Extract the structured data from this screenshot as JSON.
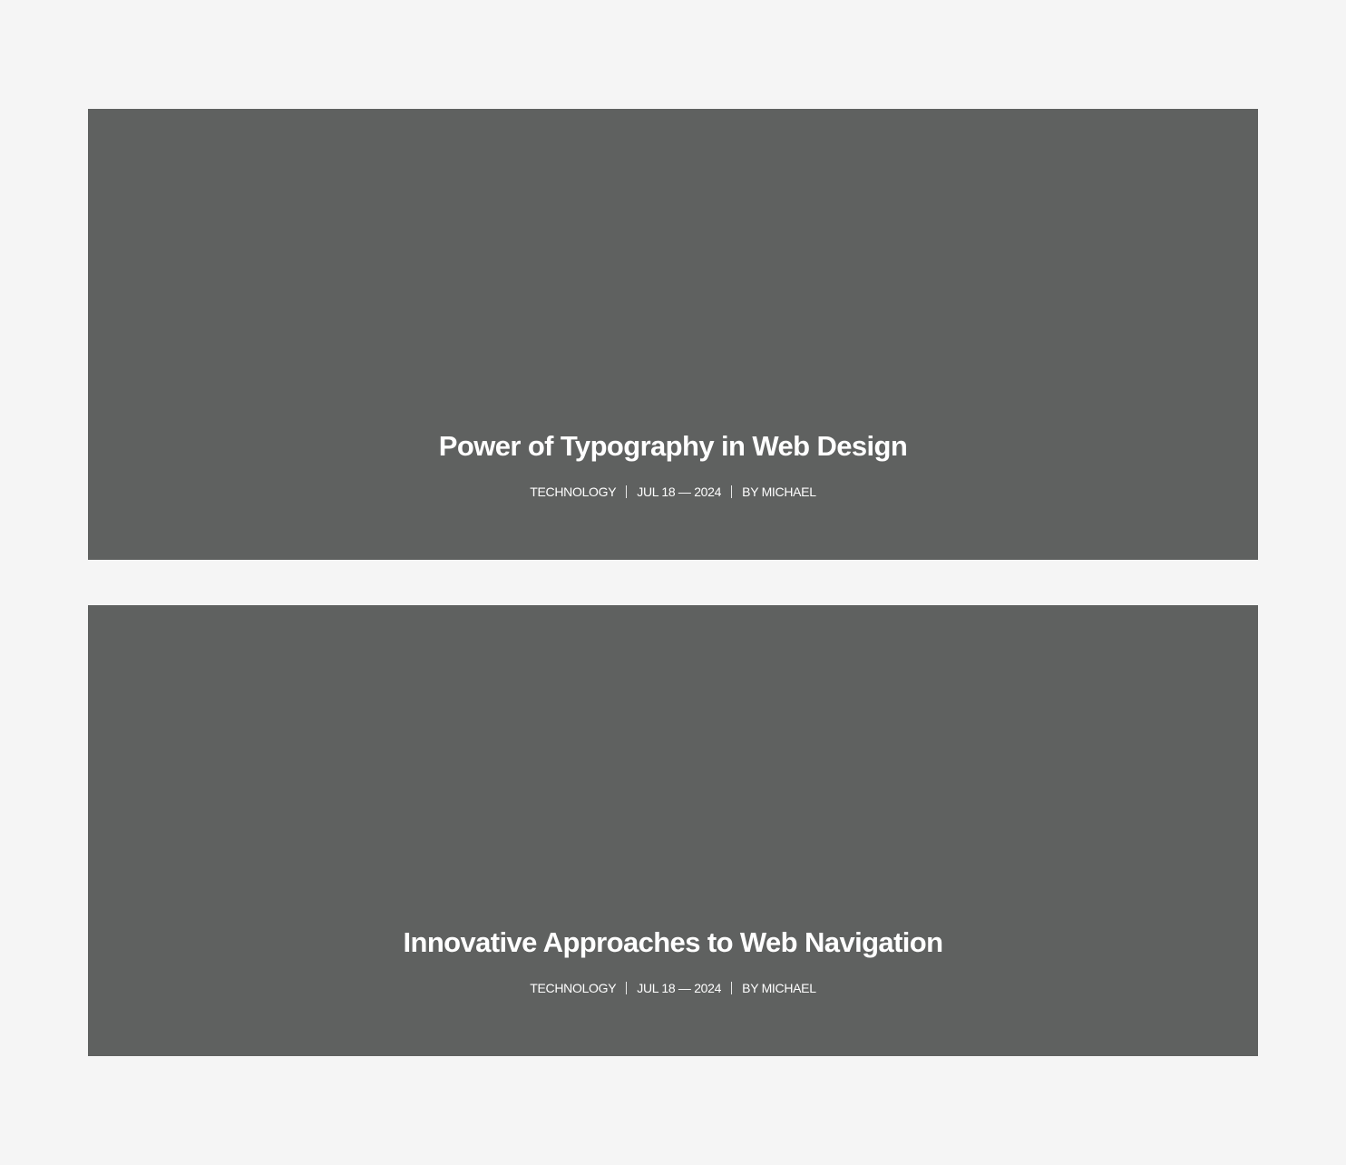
{
  "colors": {
    "page_background": "#f5f5f5",
    "card_background": "#5f6160",
    "text": "#ffffff"
  },
  "posts": [
    {
      "title": "Power of Typography in Web Design",
      "category": "TECHNOLOGY",
      "date": "JUL 18 — 2024",
      "author": "BY MICHAEL"
    },
    {
      "title": "Innovative Approaches to Web Navigation",
      "category": "TECHNOLOGY",
      "date": "JUL 18 — 2024",
      "author": "BY MICHAEL"
    }
  ]
}
